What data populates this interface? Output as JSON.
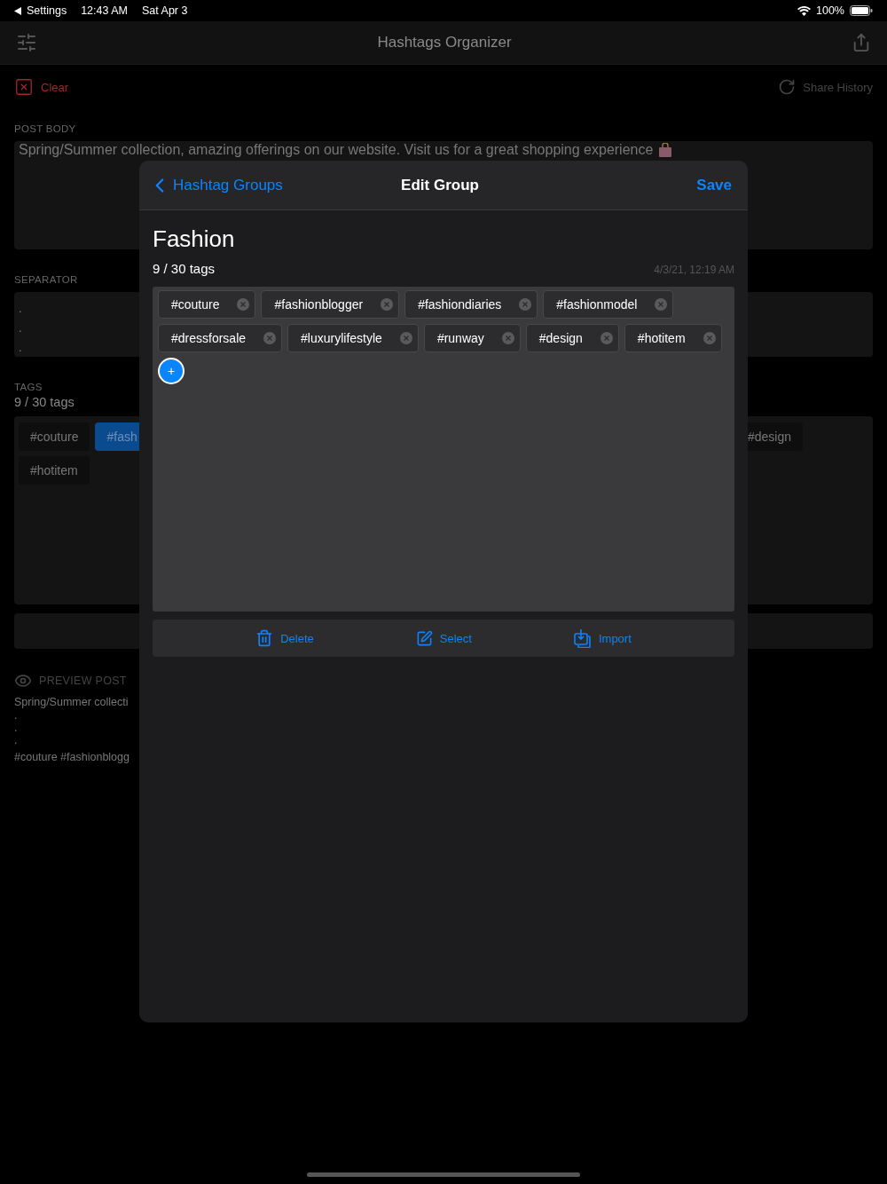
{
  "status_bar": {
    "back": "Settings",
    "time": "12:43 AM",
    "date": "Sat Apr 3",
    "battery": "100%"
  },
  "nav": {
    "title": "Hashtags Organizer"
  },
  "actions": {
    "clear": "Clear",
    "share_history": "Share History"
  },
  "post_body": {
    "label": "POST BODY",
    "text": "Spring/Summer collection, amazing offerings on our website. Visit us for a great shopping experience"
  },
  "separator": {
    "label": "SEPARATOR",
    "lines": [
      ".",
      ".",
      "."
    ]
  },
  "tags": {
    "label": "TAGS",
    "count": "9 / 30 tags",
    "rows": [
      [
        {
          "label": "#couture",
          "selected": false
        },
        {
          "label": "#fash",
          "selected": true
        },
        {
          "label": "#design",
          "selected": false
        }
      ],
      [
        {
          "label": "#hotitem",
          "selected": false
        }
      ]
    ]
  },
  "preview": {
    "label": "PREVIEW POST",
    "lines": [
      "Spring/Summer collecti",
      ".",
      ".",
      ".",
      "#couture #fashionblogg"
    ]
  },
  "modal": {
    "back": "Hashtag Groups",
    "title": "Edit Group",
    "save": "Save",
    "group_name": "Fashion",
    "count": "9 / 30 tags",
    "date": "4/3/21, 12:19 AM",
    "chips": [
      {
        "label": "#couture"
      },
      {
        "label": "#fashionblogger"
      },
      {
        "label": "#fashiondiaries"
      },
      {
        "label": "#fashionmodel"
      },
      {
        "label": "#dressforsale"
      },
      {
        "label": "#luxurylifestyle"
      },
      {
        "label": "#runway"
      },
      {
        "label": "#design"
      },
      {
        "label": "#hotitem"
      }
    ],
    "add": "+",
    "toolbar": [
      {
        "kind": "delete",
        "label": "Delete"
      },
      {
        "kind": "select",
        "label": "Select"
      },
      {
        "kind": "import",
        "label": "Import"
      }
    ]
  }
}
